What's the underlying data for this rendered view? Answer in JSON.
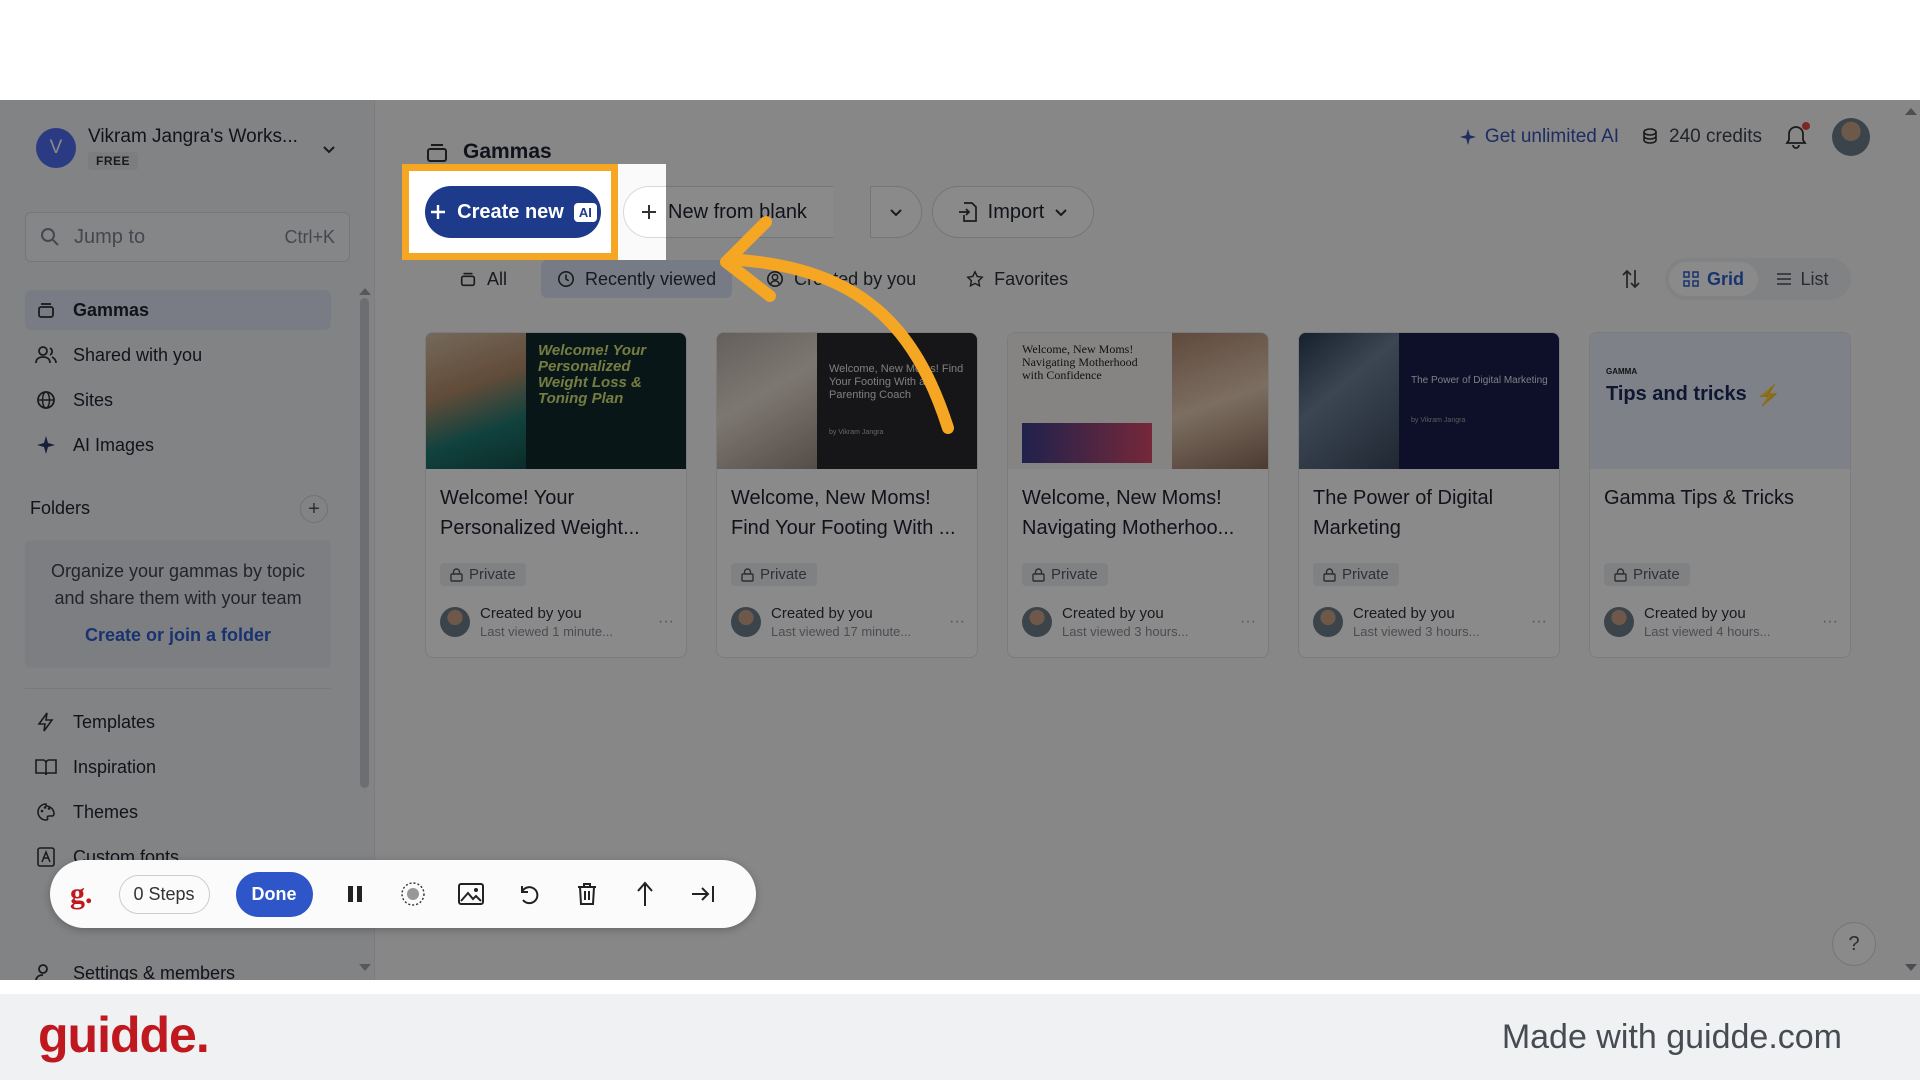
{
  "workspace": {
    "avatar_letter": "V",
    "name": "Vikram Jangra's Works...",
    "plan": "FREE"
  },
  "search": {
    "placeholder": "Jump to",
    "shortcut": "Ctrl+K"
  },
  "sidebar": {
    "items": [
      {
        "label": "Gammas",
        "icon": "stack-icon",
        "active": true
      },
      {
        "label": "Shared with you",
        "icon": "users-icon"
      },
      {
        "label": "Sites",
        "icon": "globe-icon"
      },
      {
        "label": "AI Images",
        "icon": "sparkle-icon"
      }
    ],
    "folders_title": "Folders",
    "folders_hint": "Organize your gammas by topic and share them with your team",
    "folders_link": "Create or join a folder",
    "bottom_items": [
      {
        "label": "Templates",
        "icon": "bolt-icon"
      },
      {
        "label": "Inspiration",
        "icon": "book-icon"
      },
      {
        "label": "Themes",
        "icon": "palette-icon"
      },
      {
        "label": "Custom fonts",
        "icon": "font-icon"
      }
    ],
    "settings_label": "Settings & members"
  },
  "header": {
    "title": "Gammas",
    "get_ai": "Get unlimited AI",
    "credits": "240 credits"
  },
  "actions": {
    "create_new": "Create new",
    "ai_badge": "AI",
    "new_blank": "New from blank",
    "import": "Import"
  },
  "filters": [
    {
      "label": "All",
      "icon": "stack-icon"
    },
    {
      "label": "Recently viewed",
      "icon": "clock-icon",
      "active": true
    },
    {
      "label": "Created by you",
      "icon": "user-circle-icon"
    },
    {
      "label": "Favorites",
      "icon": "star-icon"
    }
  ],
  "view": {
    "grid": "Grid",
    "list": "List",
    "active": "Grid"
  },
  "cards": [
    {
      "title": "Welcome! Your Personalized Weight...",
      "thumb_heading": "Welcome! Your Personalized Weight Loss & Toning Plan",
      "badge": "Private",
      "created": "Created by you",
      "viewed": "Last viewed 1 minute..."
    },
    {
      "title": "Welcome, New Moms! Find Your Footing With ...",
      "thumb_heading": "Welcome, New Moms! Find Your Footing With a Parenting Coach",
      "thumb_byline": "by Vikram Jangra",
      "badge": "Private",
      "created": "Created by you",
      "viewed": "Last viewed 17 minute..."
    },
    {
      "title": "Welcome, New Moms! Navigating Motherhoo...",
      "thumb_heading": "Welcome, New Moms! Navigating Motherhood with Confidence",
      "badge": "Private",
      "created": "Created by you",
      "viewed": "Last viewed 3 hours..."
    },
    {
      "title": "The Power of Digital Marketing",
      "thumb_heading": "The Power of Digital Marketing",
      "thumb_byline": "by Vikram Jangra",
      "badge": "Private",
      "created": "Created by you",
      "viewed": "Last viewed 3 hours..."
    },
    {
      "title": "Gamma Tips & Tricks",
      "thumb_heading": "Tips and tricks",
      "thumb_brand": "GAMMA",
      "badge": "Private",
      "created": "Created by you",
      "viewed": "Last viewed 4 hours..."
    }
  ],
  "help": "?",
  "recorder": {
    "logo": "g.",
    "steps": "0 Steps",
    "done": "Done"
  },
  "footer": {
    "logo": "guidde.",
    "made_with": "Made with guidde.com"
  },
  "colors": {
    "highlight": "#f5a623",
    "brand_blue": "#1d3b8a",
    "guidde_red": "#c0181f"
  }
}
